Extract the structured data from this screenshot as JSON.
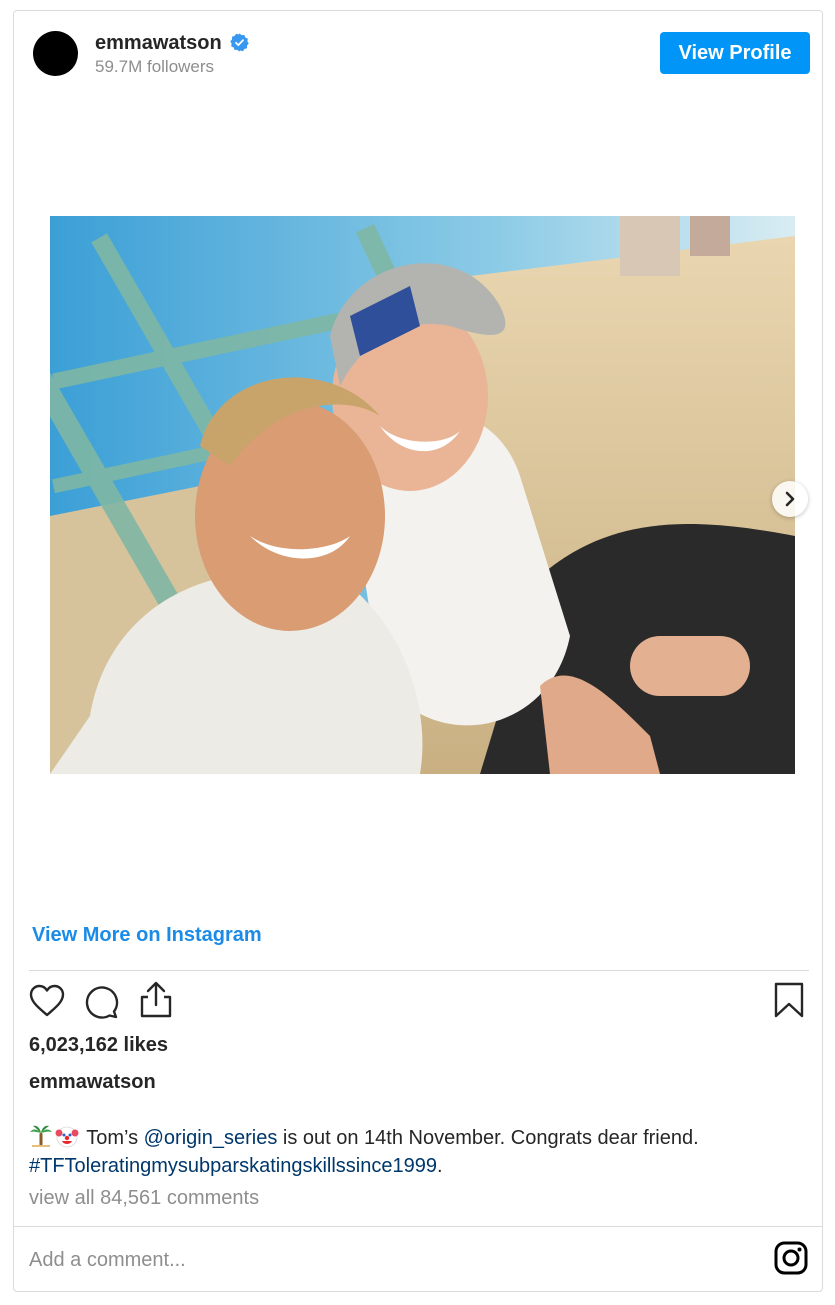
{
  "header": {
    "username": "emmawatson",
    "followers": "59.7M followers",
    "view_profile_label": "View Profile"
  },
  "media": {
    "description_icon": "photo-carousel"
  },
  "links": {
    "view_more": "View More on Instagram"
  },
  "actions": {
    "like_icon": "heart-icon",
    "comment_icon": "comment-icon",
    "share_icon": "share-icon",
    "save_icon": "bookmark-icon"
  },
  "post": {
    "likes": "6,023,162 likes",
    "caption_user": "emmawatson",
    "caption_text_1": "Tom’s ",
    "caption_mention": "@origin_series",
    "caption_text_2": " is out on 14th November. Congrats dear friend.",
    "caption_hashtag": "#TFToleratingmysubparskatingskillssince1999",
    "caption_text_3": ".",
    "view_comments": "view all 84,561 comments"
  },
  "comment": {
    "placeholder": "Add a comment..."
  },
  "colors": {
    "accent": "#0095f6",
    "link": "#00376b",
    "muted": "#8e8e8e",
    "border": "#dbdbdb"
  }
}
